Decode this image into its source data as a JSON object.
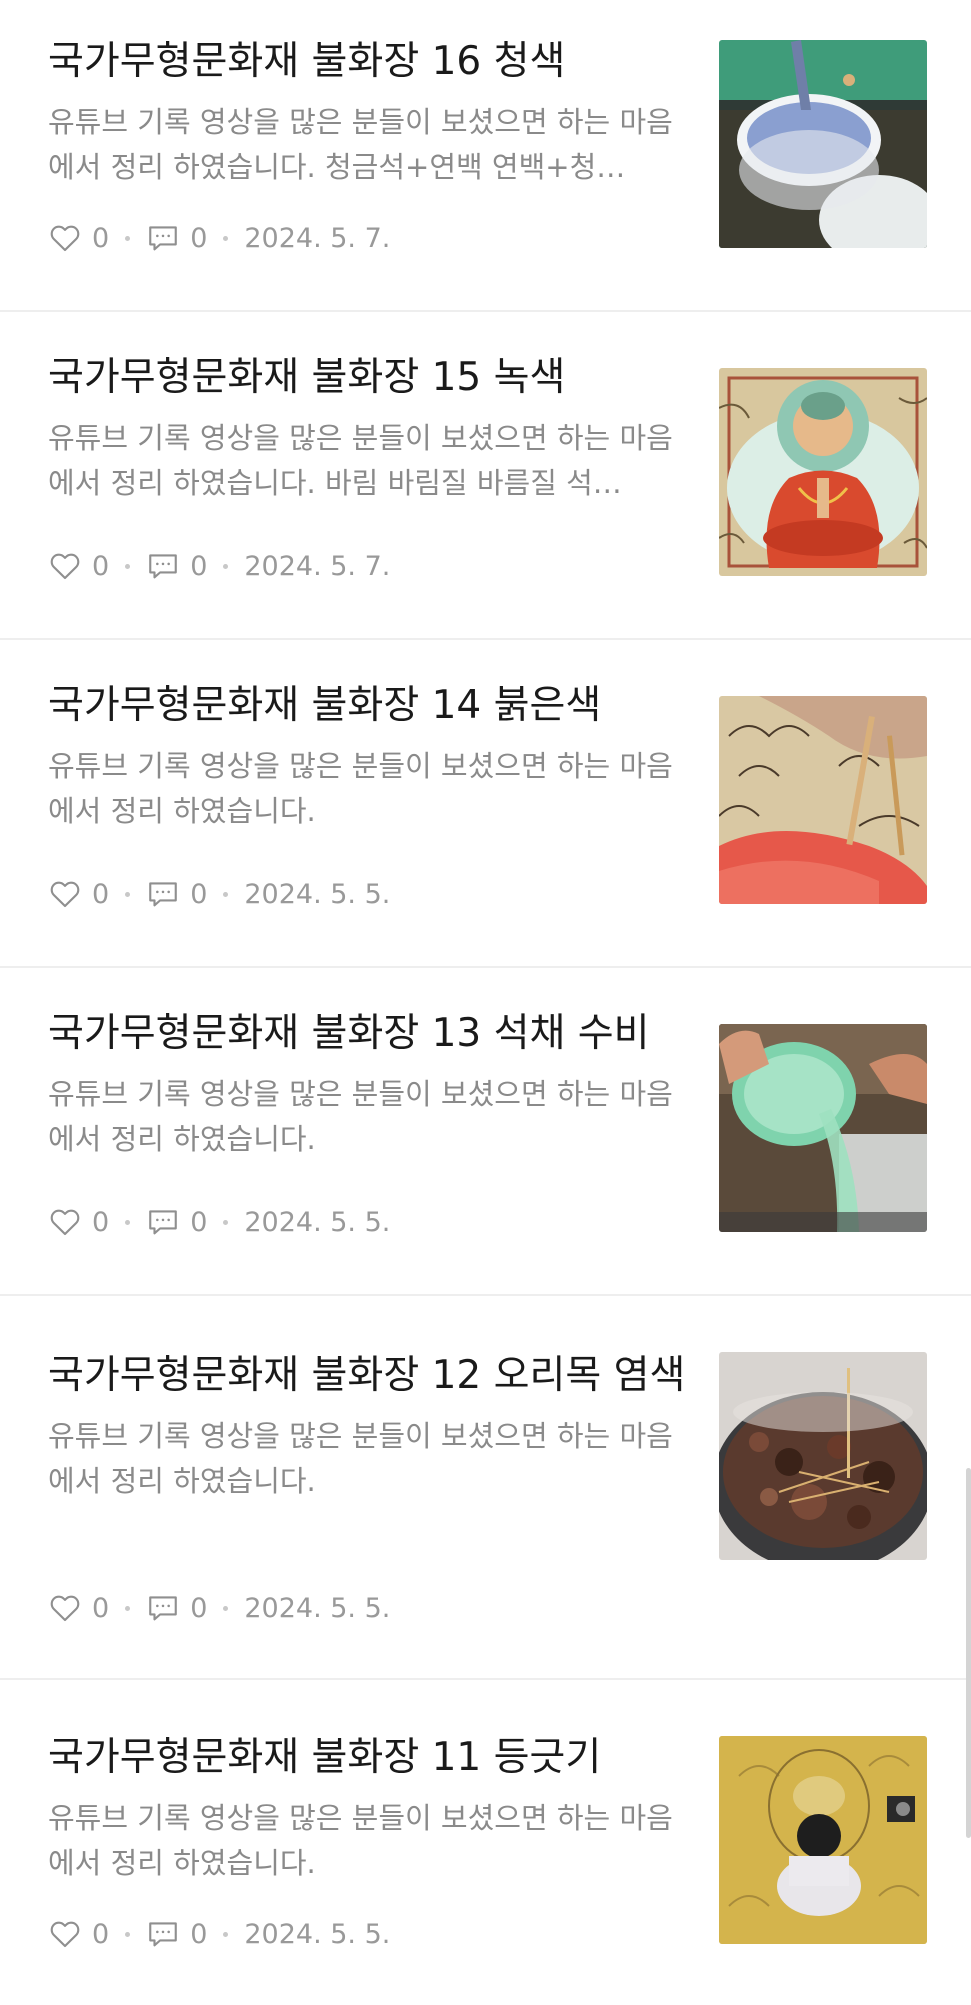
{
  "posts": [
    {
      "title": "국가무형문화재 불화장 16 청색",
      "excerpt": "유튜브 기록 영상을 많은 분들이 보셨으면 하는 마음에서 정리 하였습니다. 청금석+연백 연백+청…",
      "likes": "0",
      "comments": "0",
      "date": "2024. 5. 7.",
      "thumbnail": "blue-paint-bowl-image"
    },
    {
      "title": "국가무형문화재 불화장 15 녹색",
      "excerpt": "유튜브 기록 영상을 많은 분들이 보셨으면 하는 마음에서 정리 하였습니다. 바림 바림질 바름질 석…",
      "likes": "0",
      "comments": "0",
      "date": "2024. 5. 7.",
      "thumbnail": "buddha-painting-image"
    },
    {
      "title": "국가무형문화재 불화장 14 붉은색",
      "excerpt": "유튜브 기록 영상을 많은 분들이 보셨으면 하는 마음에서 정리 하였습니다.",
      "likes": "0",
      "comments": "0",
      "date": "2024. 5. 5.",
      "thumbnail": "red-brush-painting-image"
    },
    {
      "title": "국가무형문화재 불화장 13 석채 수비",
      "excerpt": "유튜브 기록 영상을 많은 분들이 보셨으면 하는 마음에서 정리 하였습니다.",
      "likes": "0",
      "comments": "0",
      "date": "2024. 5. 5.",
      "thumbnail": "green-pigment-pouring-image"
    },
    {
      "title": "국가무형문화재 불화장 12 오리목 염색",
      "excerpt": "유튜브 기록 영상을 많은 분들이 보셨으면 하는 마음에서 정리 하였습니다.",
      "likes": "0",
      "comments": "0",
      "date": "2024. 5. 5.",
      "thumbnail": "boiling-pot-image"
    },
    {
      "title": "국가무형문화재 불화장 11 등긋기",
      "excerpt": "유튜브 기록 영상을 많은 분들이 보셨으면 하는 마음에서 정리 하였습니다.",
      "likes": "0",
      "comments": "0",
      "date": "2024. 5. 5.",
      "thumbnail": "painter-on-canvas-image"
    }
  ],
  "icons": {
    "like": "heart-icon",
    "comment": "comment-icon"
  },
  "colors": {
    "title": "#1a1a1a",
    "excerpt": "#8a8a8a",
    "meta": "#999999",
    "divider": "#eeeeee"
  }
}
